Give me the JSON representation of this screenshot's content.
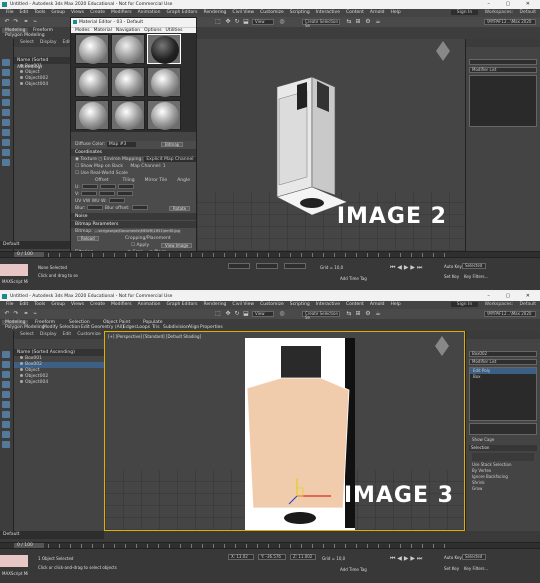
{
  "window": {
    "title": "Untitled - Autodesk 3ds Max 2020 Educational - Not for Commercial Use",
    "controls": "– ▢ ✕"
  },
  "menu": [
    "File",
    "Edit",
    "Tools",
    "Group",
    "Views",
    "Create",
    "Modifiers",
    "Animation",
    "Graph Editors",
    "Rendering",
    "Civil View",
    "Customize",
    "Scripting",
    "Interactive",
    "Content",
    "Arnold",
    "Help"
  ],
  "menu_right": {
    "sign_in": "Sign In",
    "workspaces_label": "Workspaces:",
    "workspace": "Default"
  },
  "toolbar": {
    "view_dropdown": "View",
    "selection_set": "Create Selection Se",
    "project_path": "\\MYPAF12...\\Max 2020"
  },
  "ribbon": {
    "tabs1": [
      "Modeling",
      "Freeform"
    ],
    "sub1": "Polygon Modeling",
    "tabs2": [
      "Modeling",
      "Freeform",
      "Selection",
      "Object Paint",
      "Populate"
    ],
    "sub2": [
      "Polygon Modeling",
      "Modify Selection",
      "Edit",
      "Geometry (All)",
      "Edges",
      "Loops",
      "Tris",
      "Subdivision",
      "Align",
      "Properties"
    ]
  },
  "scene_explorer": {
    "tabs": [
      "Select",
      "Display",
      "Edit",
      "Customize"
    ],
    "header": "Name (Sorted Ascending)",
    "items1": [
      "Box001",
      "Object",
      "Object002",
      "Object004"
    ],
    "items2": [
      "Box001",
      "Box002",
      "Object",
      "Object002",
      "Object004"
    ],
    "selected2": "Box002"
  },
  "material_editor": {
    "title": "Material Editor - 03 - Default",
    "menu": [
      "Modes",
      "Material",
      "Navigation",
      "Options",
      "Utilities"
    ],
    "diffuse_label": "Diffuse Color:",
    "map_name": "Map #3",
    "bitmap_btn": "Bitmap",
    "coordinates_title": "Coordinates",
    "texture_opt": "Texture",
    "environ_opt": "Environ",
    "mapping_label": "Mapping:",
    "mapping_value": "Explicit Map Channel",
    "show_map_on_back": "Show Map on Back",
    "map_channel_label": "Map Channel:",
    "map_channel_value": "1",
    "use_real_world": "Use Real-World Scale",
    "offset": "Offset",
    "tiling": "Tiling",
    "mirror_tile": "Mirror Tile",
    "angle": "Angle",
    "u_label": "U:",
    "v_label": "V:",
    "w_label": "W:",
    "uv_opts": "UV  VW  WU",
    "blur_label": "Blur:",
    "blur_offset_label": "Blur offset:",
    "rotate_btn": "Rotate",
    "noise_title": "Noise",
    "bitmap_params_title": "Bitmap Parameters",
    "bitmap_label": "Bitmap:",
    "bitmap_path": "...ser\\george\\Documents\\MEWR\\1R51\\emf0.jpg",
    "reload_btn": "Reload",
    "cropping_label": "Cropping/Placement",
    "apply_label": "Apply",
    "view_image_btn": "View Image",
    "crop_opt": "Crop",
    "place_opt": "Place",
    "filtering_label": "Filtering",
    "pyramidal": "Pyramidal",
    "summed_area": "Summed Area",
    "none_opt": "None",
    "mono_output": "Mono Channel Output:",
    "rgb_intensity": "RGB Intensity"
  },
  "viewport1": {
    "caption": "IMAGE 2"
  },
  "viewport2": {
    "label": "[+] [Perspective] [Standard] [Default Shading]",
    "caption": "IMAGE 3"
  },
  "command_panel1": {
    "modifier_list": "Modifier List"
  },
  "command_panel2": {
    "object_name": "Box002",
    "modifier_list": "Modifier List",
    "stack": [
      "Edit Poly",
      "Box"
    ],
    "selection_title": "Selection",
    "options": [
      "Use Stack Selection",
      "By Vertex",
      "Ignore Backfacing",
      "Shrink",
      "Grow"
    ],
    "show_cage": "Show Cage"
  },
  "status1": {
    "default_label": "Default",
    "frame": "0 / 100",
    "line1": "None Selected",
    "line2": "Click and drag to se",
    "script_label": "MAXScript Mi",
    "autokey": "Auto Key",
    "selected": "Selected",
    "setkey": "Set Key",
    "keyfilters": "Key Filters...",
    "grid": "Grid = 10,0",
    "addtime": "Add Time Tag"
  },
  "status2": {
    "default_label": "Default",
    "frame": "0 / 100",
    "line1": "1 Object Selected",
    "line2": "Click or click-and-drag to select objects",
    "script_label": "MAXScript Mi",
    "x": "X: 13.02",
    "y": "Y: -36.576",
    "z": "Z: 11.002",
    "autokey": "Auto Key",
    "selected": "Selected",
    "setkey": "Set Key",
    "keyfilters": "Key Filters...",
    "grid": "Grid = 10,0",
    "addtime": "Add Time Tag"
  },
  "colors": {
    "app_bg": "#3a3a3a",
    "viewport_bg": "#454545",
    "selection_blue": "#3d5f84",
    "box_face": "#f1ccac",
    "caption": "#ffffff"
  }
}
